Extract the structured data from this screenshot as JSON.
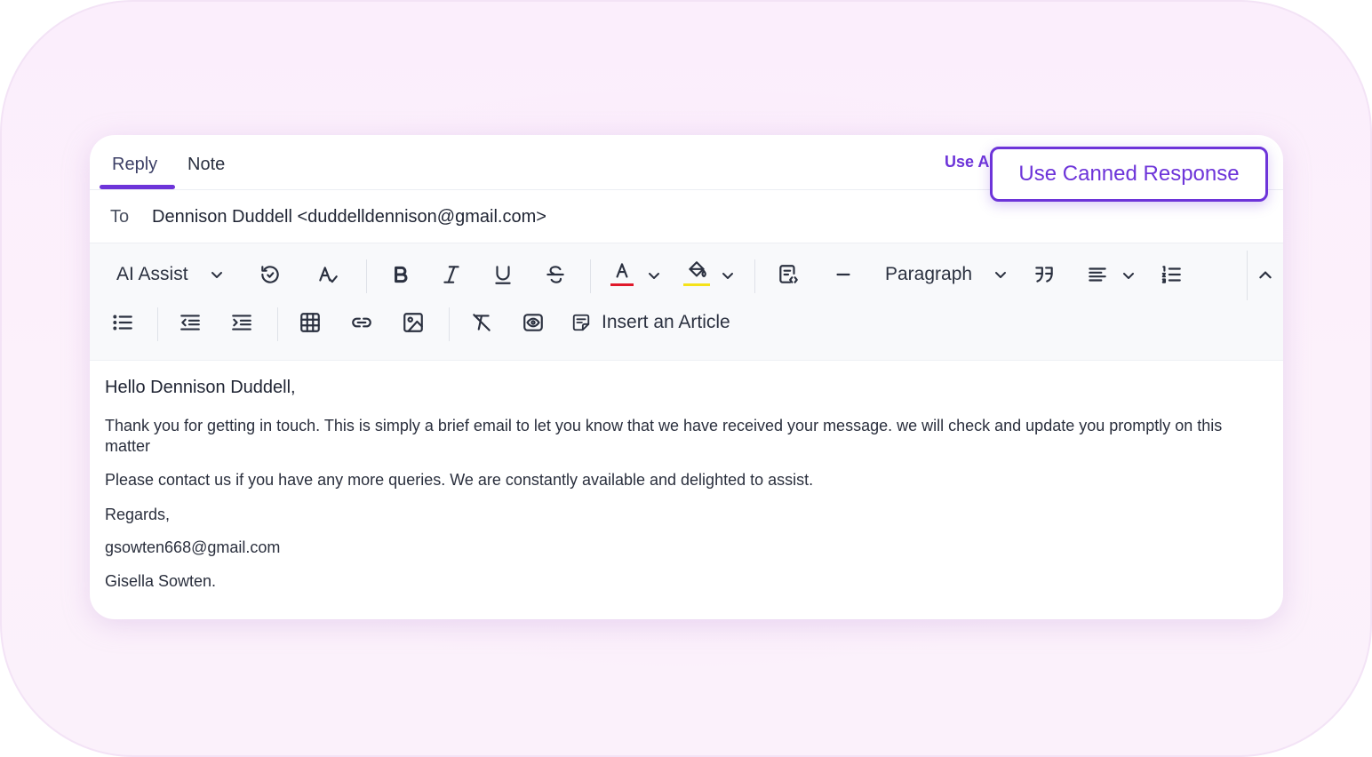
{
  "tabs": [
    {
      "label": "Reply",
      "active": true
    },
    {
      "label": "Note",
      "active": false
    }
  ],
  "use_ai_label": "Use A",
  "canned_button_label": "Use Canned Response",
  "to": {
    "label": "To",
    "value": "Dennison Duddell <duddelldennison@gmail.com>"
  },
  "toolbar": {
    "ai_assist_label": "AI Assist",
    "paragraph_label": "Paragraph",
    "insert_article_label": "Insert an Article",
    "text_color_underline": "#e0192b",
    "highlight_underline": "#f5e21a"
  },
  "message": {
    "greeting": "Hello Dennison Duddell,",
    "para1": "Thank you for getting in touch. This is simply a brief email to let you know that we have received your message. we will check and update you promptly on this matter",
    "para2": "Please contact us if you have any more queries. We are constantly available and delighted to assist.",
    "closing": "Regards,",
    "email": "gsowten668@gmail.com",
    "signature": "Gisella Sowten."
  },
  "colors": {
    "accent": "#6d34d9"
  }
}
